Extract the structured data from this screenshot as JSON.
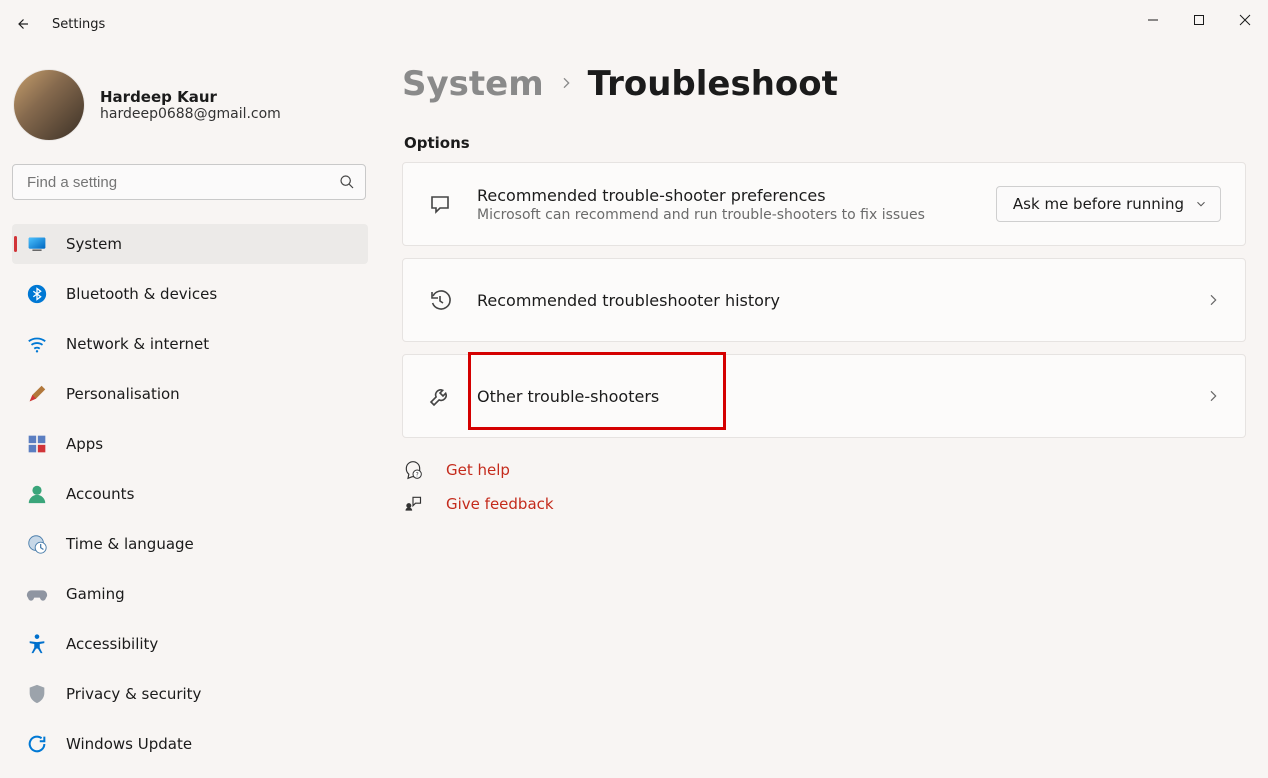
{
  "app_title": "Settings",
  "user": {
    "name": "Hardeep Kaur",
    "email": "hardeep0688@gmail.com"
  },
  "search": {
    "placeholder": "Find a setting"
  },
  "nav": [
    {
      "label": "System",
      "selector": "system"
    },
    {
      "label": "Bluetooth & devices",
      "selector": "bt"
    },
    {
      "label": "Network & internet",
      "selector": "net"
    },
    {
      "label": "Personalisation",
      "selector": "pers"
    },
    {
      "label": "Apps",
      "selector": "apps"
    },
    {
      "label": "Accounts",
      "selector": "accounts"
    },
    {
      "label": "Time & language",
      "selector": "time"
    },
    {
      "label": "Gaming",
      "selector": "gaming"
    },
    {
      "label": "Accessibility",
      "selector": "access"
    },
    {
      "label": "Privacy & security",
      "selector": "privacy"
    },
    {
      "label": "Windows Update",
      "selector": "update"
    }
  ],
  "breadcrumb": {
    "parent": "System",
    "leaf": "Troubleshoot"
  },
  "section_heading": "Options",
  "rows": {
    "prefs": {
      "title": "Recommended trouble-shooter preferences",
      "subtitle": "Microsoft can recommend and run trouble-shooters to fix issues",
      "dropdown": "Ask me before running"
    },
    "history": {
      "title": "Recommended troubleshooter history"
    },
    "other": {
      "title": "Other trouble-shooters"
    }
  },
  "footer": {
    "help": "Get help",
    "feedback": "Give feedback"
  }
}
